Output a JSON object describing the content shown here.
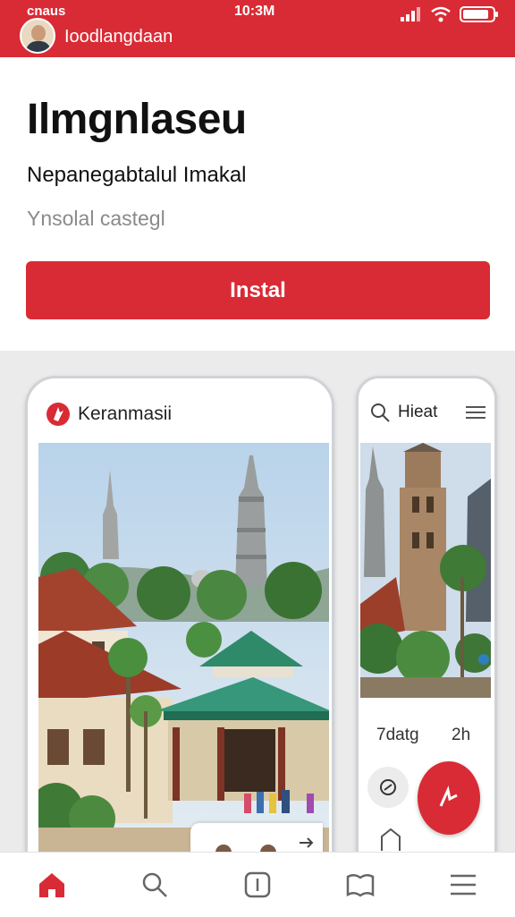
{
  "status_bar": {
    "carrier": "cnaus",
    "time": "10:3M",
    "icons": [
      "signal-icon",
      "wifi-icon",
      "battery-icon"
    ]
  },
  "header": {
    "app_name": "Ioodlangdaan"
  },
  "hero": {
    "title": "Ilmgnlaseu",
    "subtitle": "Nepanegabtalul Imakal",
    "meta": "Ynsolal castegl",
    "install_label": "Instal"
  },
  "screenshots": {
    "phone1": {
      "title": "Keranmasii",
      "icon": "brand-logo-icon"
    },
    "phone2": {
      "search_label": "Hieat",
      "info_label": "7datg",
      "info_value": "2h",
      "icons": [
        "search-icon",
        "menu-icon",
        "tag-icon",
        "edit-icon"
      ]
    }
  },
  "bottom_nav": {
    "items": [
      {
        "icon": "home-icon",
        "active": true
      },
      {
        "icon": "search-icon",
        "active": false
      },
      {
        "icon": "info-icon",
        "active": false
      },
      {
        "icon": "book-icon",
        "active": false
      },
      {
        "icon": "menu-icon",
        "active": false
      }
    ]
  },
  "colors": {
    "brand": "#d92b35",
    "background": "#ffffff",
    "gallery_background": "#ebebeb"
  }
}
